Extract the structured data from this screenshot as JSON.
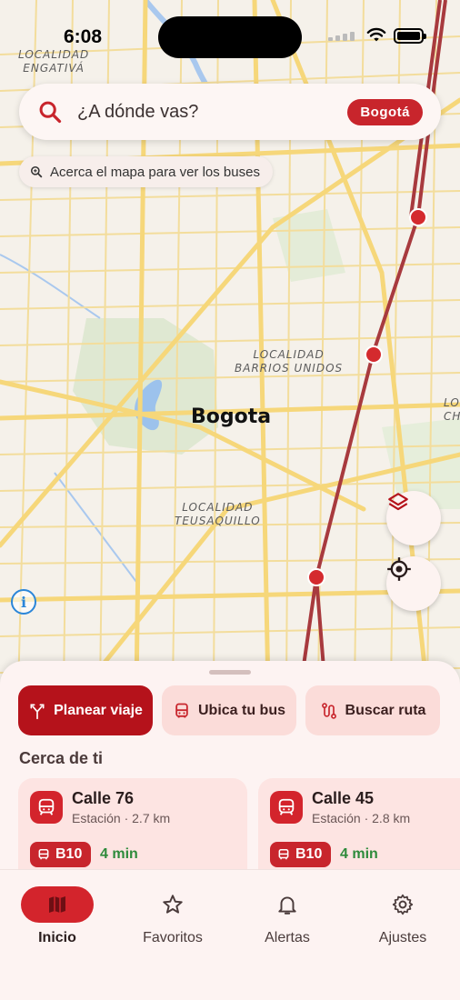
{
  "status_bar": {
    "time": "6:08"
  },
  "map": {
    "city_label": "Bogota",
    "district_labels": [
      {
        "line1": "LOCALIDAD",
        "line2": "ENGATIVÁ"
      },
      {
        "line1": "LOCALIDAD",
        "line2": "BARRIOS UNIDOS"
      },
      {
        "line1": "LOCALIDAD",
        "line2": "TEUSAQUILLO"
      },
      {
        "line1": "LO",
        "line2": "CH"
      }
    ],
    "info_glyph": "i"
  },
  "search": {
    "placeholder": "¿A dónde vas?",
    "city_chip": "Bogotá",
    "hint": "Acerca el mapa para ver los buses"
  },
  "actions": [
    {
      "label": "Planear viaje",
      "icon": "split-route-icon",
      "primary": true
    },
    {
      "label": "Ubica tu bus",
      "icon": "bus-icon",
      "primary": false
    },
    {
      "label": "Buscar ruta",
      "icon": "route-icon",
      "primary": false
    }
  ],
  "nearby": {
    "title": "Cerca de ti",
    "stops": [
      {
        "name": "Calle 76",
        "meta": "Estación · 2.7 km",
        "route": "B10",
        "eta": "4 min"
      },
      {
        "name": "Calle 45",
        "meta": "Estación · 2.8 km",
        "route": "B10",
        "eta": "4 min"
      }
    ]
  },
  "nav": {
    "items": [
      {
        "label": "Inicio",
        "icon": "map-icon",
        "active": true
      },
      {
        "label": "Favoritos",
        "icon": "star-icon",
        "active": false
      },
      {
        "label": "Alertas",
        "icon": "bell-icon",
        "active": false
      },
      {
        "label": "Ajustes",
        "icon": "gear-icon",
        "active": false
      }
    ]
  },
  "colors": {
    "brand_red": "#c8252c",
    "primary_action": "#b5121b",
    "eta_green": "#2e8b3b",
    "transit_line": "#a83a3e",
    "road": "#f6d77a"
  }
}
